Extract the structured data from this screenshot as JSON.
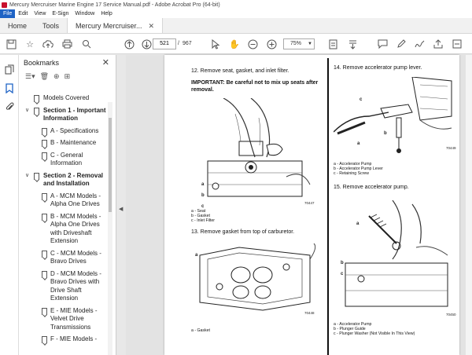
{
  "window": {
    "title": "Mercury Mercruiser Marine Engine 17 Service Manual.pdf - Adobe Acrobat Pro (64-bit)"
  },
  "menu": [
    "File",
    "Edit",
    "View",
    "E-Sign",
    "Window",
    "Help"
  ],
  "tabs": {
    "home": "Home",
    "tools": "Tools",
    "doc": "Mercury Mercruiser..."
  },
  "toolbar": {
    "page_current": "521",
    "page_sep": "/",
    "page_total": "967",
    "zoom": "75%"
  },
  "bookmarks": {
    "title": "Bookmarks",
    "items": [
      {
        "label": "Models Covered"
      },
      {
        "label": "Section 1 - Important Information"
      },
      {
        "label": "A - Specifications"
      },
      {
        "label": "B - Maintenance"
      },
      {
        "label": "C - General Information"
      },
      {
        "label": "Section 2 - Removal and Installation"
      },
      {
        "label": "A - MCM Models - Alpha One Drives"
      },
      {
        "label": "B - MCM Models - Alpha One Drives with Driveshaft Extension"
      },
      {
        "label": "C - MCM Models - Bravo Drives"
      },
      {
        "label": "D - MCM Models - Bravo Drives with Drive Shaft Extension"
      },
      {
        "label": "E - MIE Models - Velvet Drive Transmissions"
      },
      {
        "label": "F - MIE Models -"
      }
    ]
  },
  "document": {
    "step12": "12. Remove seat, gasket, and inlet filter.",
    "important": "IMPORTANT: Be careful not to mix up seats after removal.",
    "fig1_code": "70447",
    "fig1_legend": [
      "a - Seat",
      "b - Gasket",
      "c - Inlet Filter"
    ],
    "step13": "13. Remove gasket from top of carburetor.",
    "fig2_code": "70448",
    "fig2_legend": [
      "a - Gasket"
    ],
    "step14": "14. Remove accelerator pump lever.",
    "fig3_code": "70449",
    "fig3_legend": [
      "a - Accelerator Pump",
      "b - Accelerator Pump Lever",
      "c - Retaining Screw"
    ],
    "step15": "15. Remove accelerator pump.",
    "fig4_code": "70450",
    "fig4_legend": [
      "a - Accelerator Pump",
      "b - Plunger Guide",
      "c - Plunger Washer (Not Visible In This View)"
    ],
    "callouts": [
      "a",
      "b",
      "c"
    ]
  }
}
